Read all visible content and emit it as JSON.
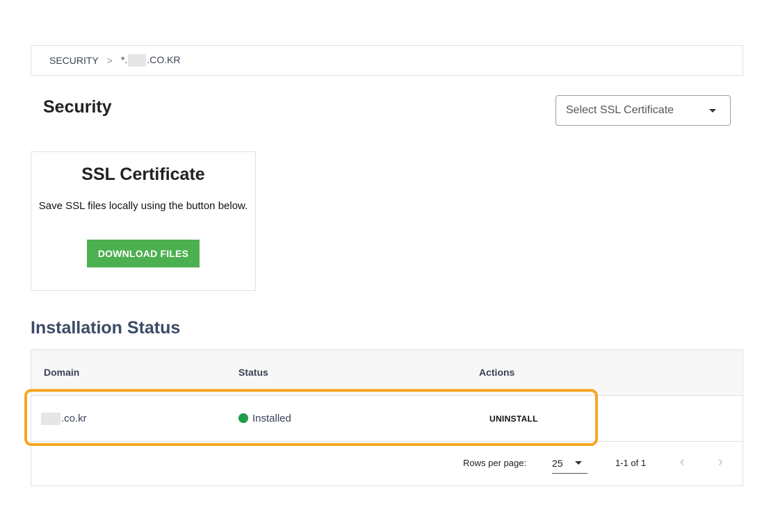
{
  "breadcrumb": {
    "root": "SECURITY",
    "separator": ">",
    "current_prefix": "*.",
    "current_suffix": ".CO.KR"
  },
  "page": {
    "title": "Security"
  },
  "cert_select": {
    "placeholder": "Select SSL Certificate",
    "icon": "chevron-down-icon"
  },
  "ssl_card": {
    "title": "SSL Certificate",
    "description": "Save SSL files locally using the button below.",
    "button_label": "DOWNLOAD FILES",
    "button_color": "#4caf50"
  },
  "installation": {
    "title": "Installation Status",
    "columns": [
      "Domain",
      "Status",
      "Actions"
    ],
    "rows": [
      {
        "domain_suffix": ".co.kr",
        "status": "Installed",
        "status_color": "#1f9d4c",
        "action": "UNINSTALL"
      }
    ],
    "pagination": {
      "rows_per_page_label": "Rows per page:",
      "rows_per_page": "25",
      "range": "1-1 of 1",
      "prev_icon": "chevron-left-icon",
      "next_icon": "chevron-right-icon"
    }
  },
  "highlight_color": "#f5a623"
}
